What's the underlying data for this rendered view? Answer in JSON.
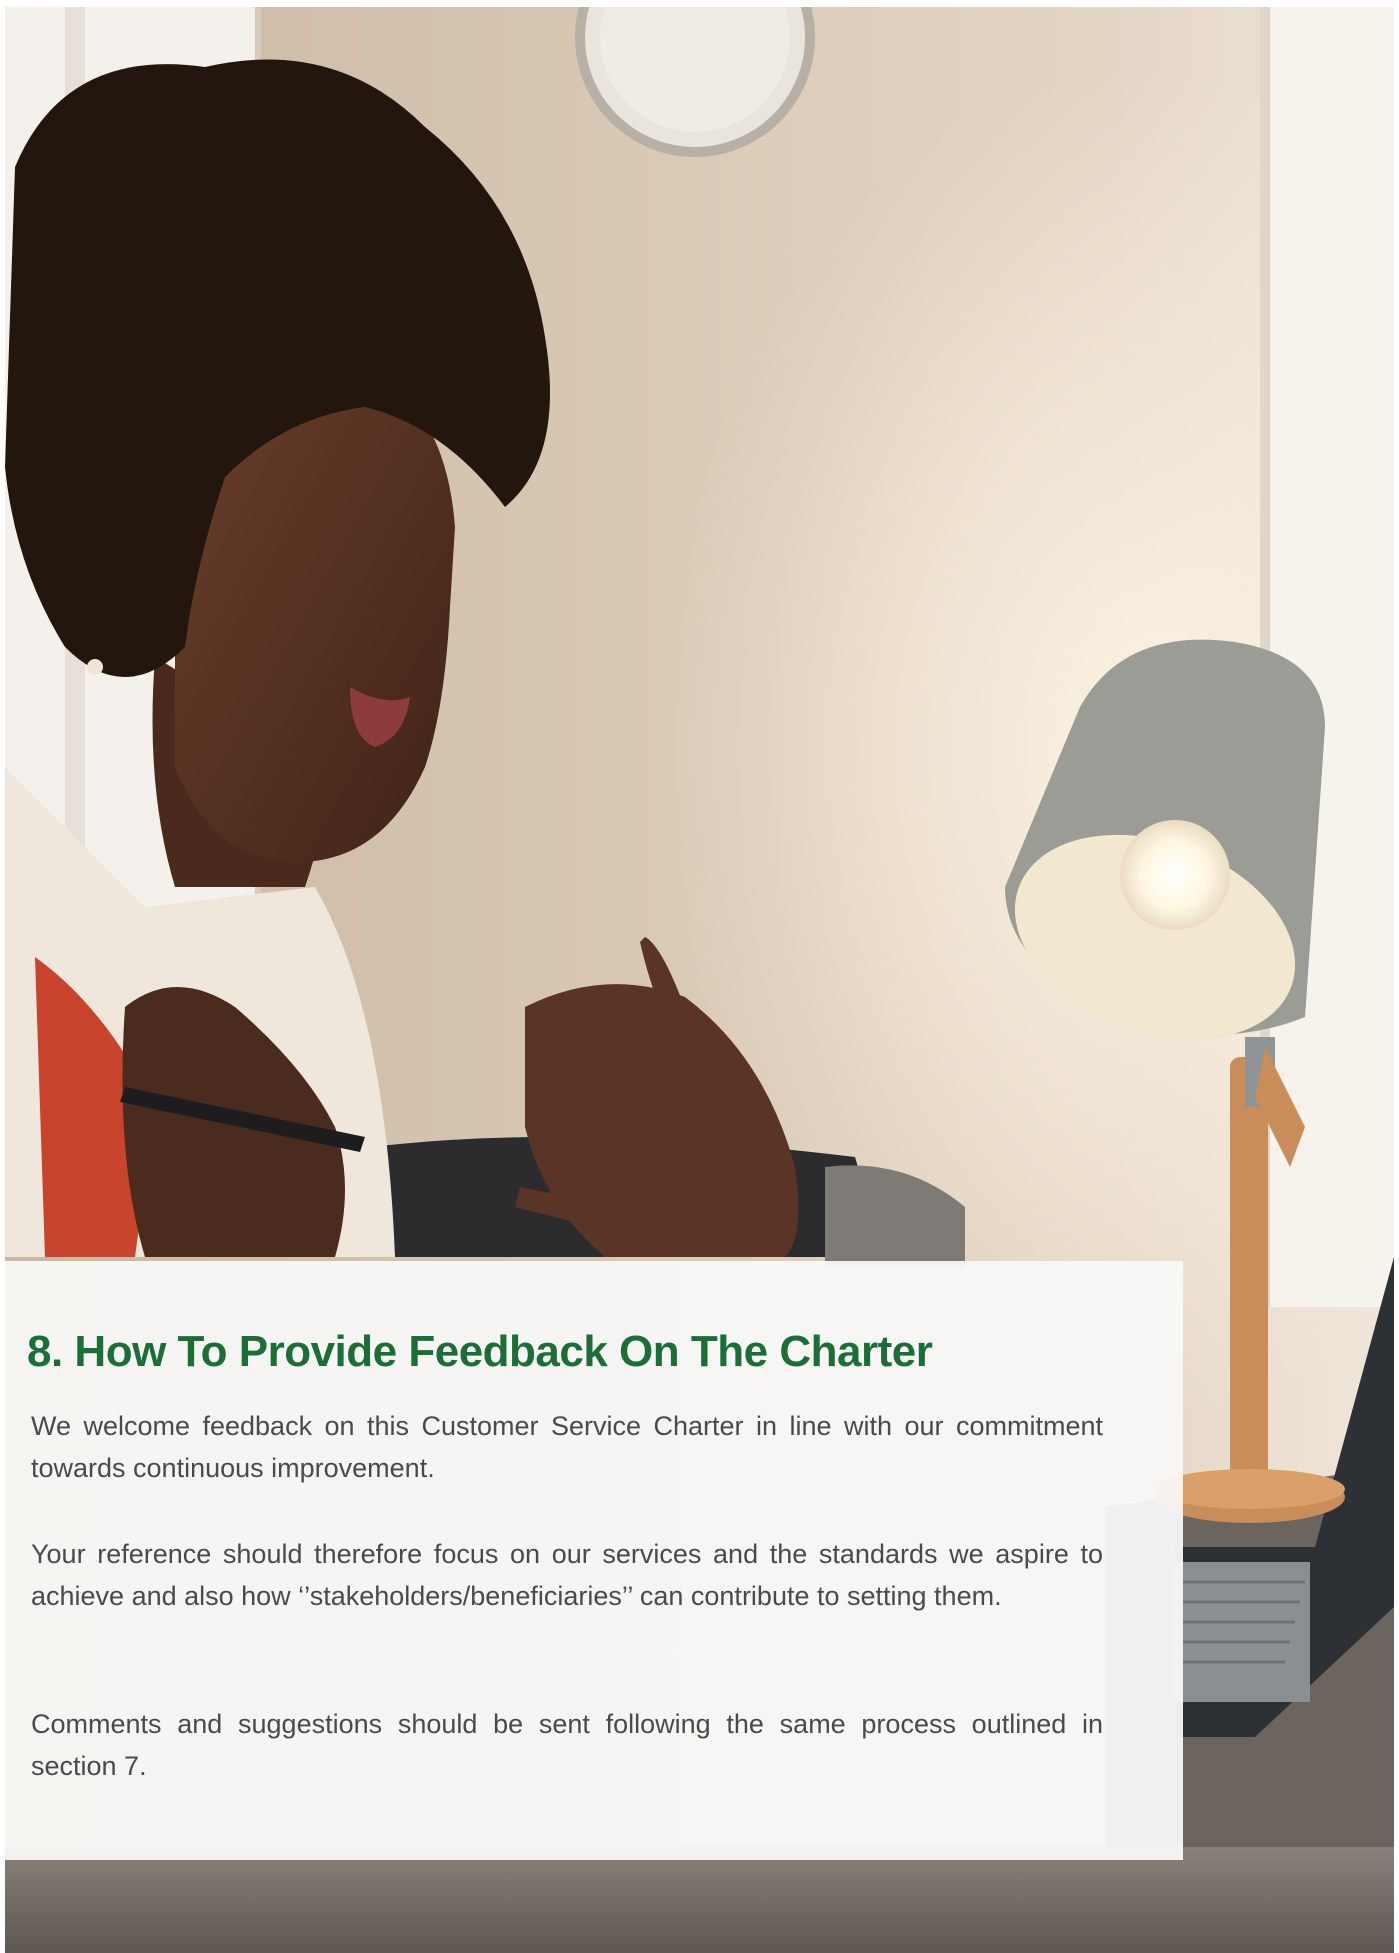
{
  "photo": {
    "description_icon": "woman-at-laptop-photo"
  },
  "colors": {
    "heading": "#1c6e37",
    "body_text": "#4a4a4a",
    "card_background": "#f8f8f7"
  },
  "section": {
    "heading": "8. How To Provide Feedback On The Charter",
    "paragraphs": [
      "We welcome feedback on this Customer Service Charter in line with our commitment towards continuous improvement.",
      "Your reference should therefore focus on our services and the standards we aspire to achieve and also how ‘’stakeholders/beneficiaries’’ can contribute to setting them.",
      "Comments and suggestions should be sent following the same process outlined in section 7."
    ]
  }
}
